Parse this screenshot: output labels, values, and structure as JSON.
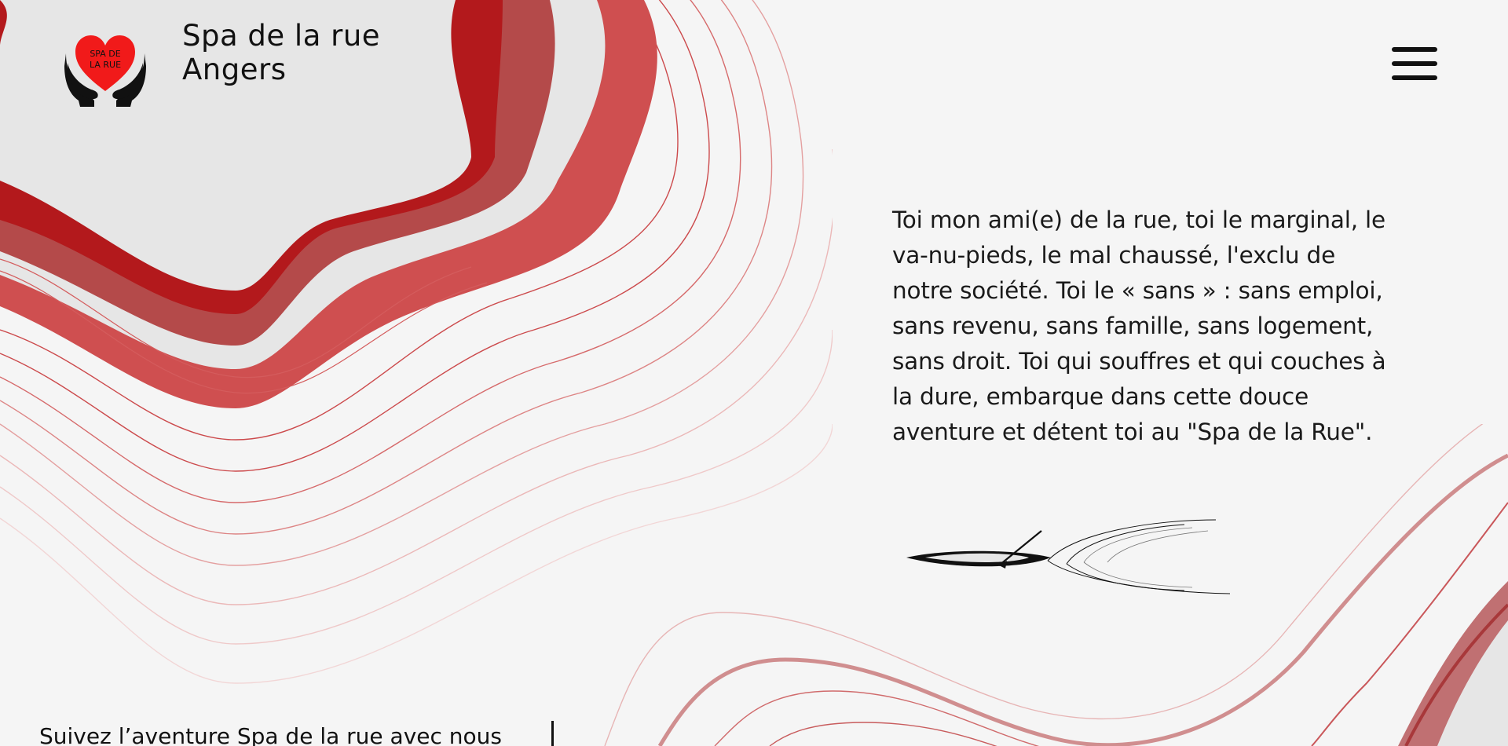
{
  "header": {
    "brand_line1": "Spa de la rue",
    "brand_line2": "Angers",
    "logo_icon": "hands-heart-logo",
    "logo_text": "SPA DE LA RUE",
    "menu_icon": "hamburger-menu-icon"
  },
  "main": {
    "intro_text": "Toi mon ami(e) de la rue, toi le marginal, le va-nu-pieds, le mal chaussé, l'exclu de notre société. Toi le « sans » : sans emploi, sans revenu, sans famille, sans logement, sans droit. Toi qui souffres et qui couches à la dure, embarque dans cette douce aventure et détent toi au \"Spa de la Rue\".",
    "illustration_icon": "canoe-icon"
  },
  "footer": {
    "follow_text": "Suivez l’aventure Spa de la rue avec nous"
  },
  "colors": {
    "background": "#f5f5f5",
    "deep_red": "#b3191c",
    "mid_red": "#b44a4a",
    "light_red": "#cf4f50",
    "pale_fill": "#e6e6e6",
    "text": "#111111"
  }
}
